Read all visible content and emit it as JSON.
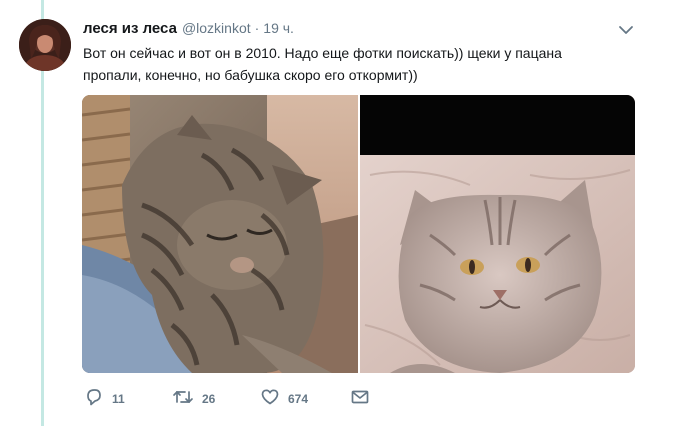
{
  "tweet": {
    "display_name": "леся из леса",
    "handle": "@lozkinkot",
    "separator": "·",
    "time": "19 ч.",
    "text_lines": [
      "Вот он сейчас и вот он в 2010. Надо еще фотки поискать)) щеки у пацана",
      "пропали, конечно, но бабушка скоро его откормит))"
    ]
  },
  "icons": {
    "caret": "chevron-down-icon",
    "reply": "reply-icon",
    "retweet": "retweet-icon",
    "like": "heart-icon",
    "dm": "envelope-icon"
  },
  "actions": {
    "reply_count": "11",
    "retweet_count": "26",
    "like_count": "674"
  },
  "colors": {
    "thread_line": "#c4e8e3",
    "secondary_text": "#657786",
    "primary_text": "#14171a"
  }
}
